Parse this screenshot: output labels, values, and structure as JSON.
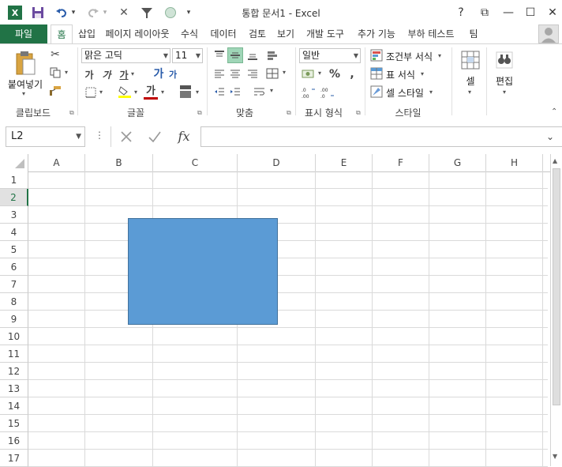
{
  "window": {
    "title": "통합 문서1 - Excel"
  },
  "qat": {
    "undo_dd": "▾",
    "more": "▾"
  },
  "window_buttons": {
    "help": "?",
    "restore_ribbon": "⧉",
    "minimize": "—",
    "maximize": "☐",
    "close": "✕"
  },
  "tabs": {
    "file": "파일",
    "items": [
      "홈",
      "삽입",
      "페이지 레이아웃",
      "수식",
      "데이터",
      "검토",
      "보기",
      "개발 도구",
      "추가 기능",
      "부하 테스트",
      "팀"
    ]
  },
  "ribbon": {
    "clipboard": {
      "label": "클립보드",
      "paste": "붙여넣기"
    },
    "font": {
      "label": "글꼴",
      "name": "맑은 고딕",
      "size": "11",
      "bold": "가",
      "italic": "가",
      "underline": "가",
      "grow": "가",
      "color_glyph": "가"
    },
    "alignment": {
      "label": "맞춤"
    },
    "number": {
      "label": "표시 형식",
      "format": "일반"
    },
    "styles": {
      "label": "스타일",
      "conditional": "조건부 서식",
      "table": "표 서식",
      "cell_styles": "셀 스타일"
    },
    "cells": {
      "label": "셀"
    },
    "editing": {
      "label": "편집"
    }
  },
  "formula": {
    "name_box": "L2",
    "fx": "fx",
    "value": ""
  },
  "sheet": {
    "columns": [
      "A",
      "B",
      "C",
      "D",
      "E",
      "F",
      "G",
      "H"
    ],
    "rows": [
      "1",
      "2",
      "3",
      "4",
      "5",
      "6",
      "7",
      "8",
      "9",
      "10",
      "11",
      "12",
      "13",
      "14",
      "15",
      "16",
      "17"
    ],
    "selected_row": "2",
    "shape_color": "#5b9bd5"
  },
  "colors": {
    "accent": "#217346"
  }
}
